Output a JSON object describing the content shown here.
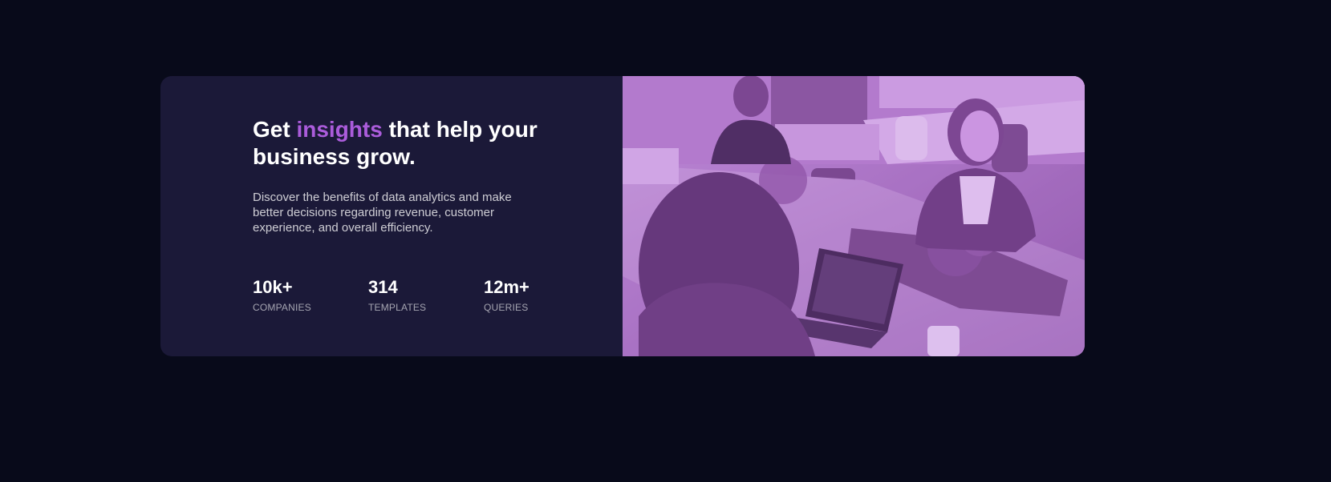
{
  "hero": {
    "headline_pre": "Get",
    "headline_accent": "insights",
    "headline_post": "that help your business grow.",
    "description": "Discover the benefits of data analytics and make better decisions regarding revenue, customer experience, and overall efficiency."
  },
  "stats": [
    {
      "value": "10k+",
      "label": "COMPANIES"
    },
    {
      "value": "314",
      "label": "TEMPLATES"
    },
    {
      "value": "12m+",
      "label": "QUERIES"
    }
  ],
  "image": {
    "icon": "team-photo-icon"
  },
  "colors": {
    "background": "#080a1a",
    "card": "#1b1938",
    "accent": "#ab5cdb",
    "image_overlay": "#aa5cdb"
  }
}
